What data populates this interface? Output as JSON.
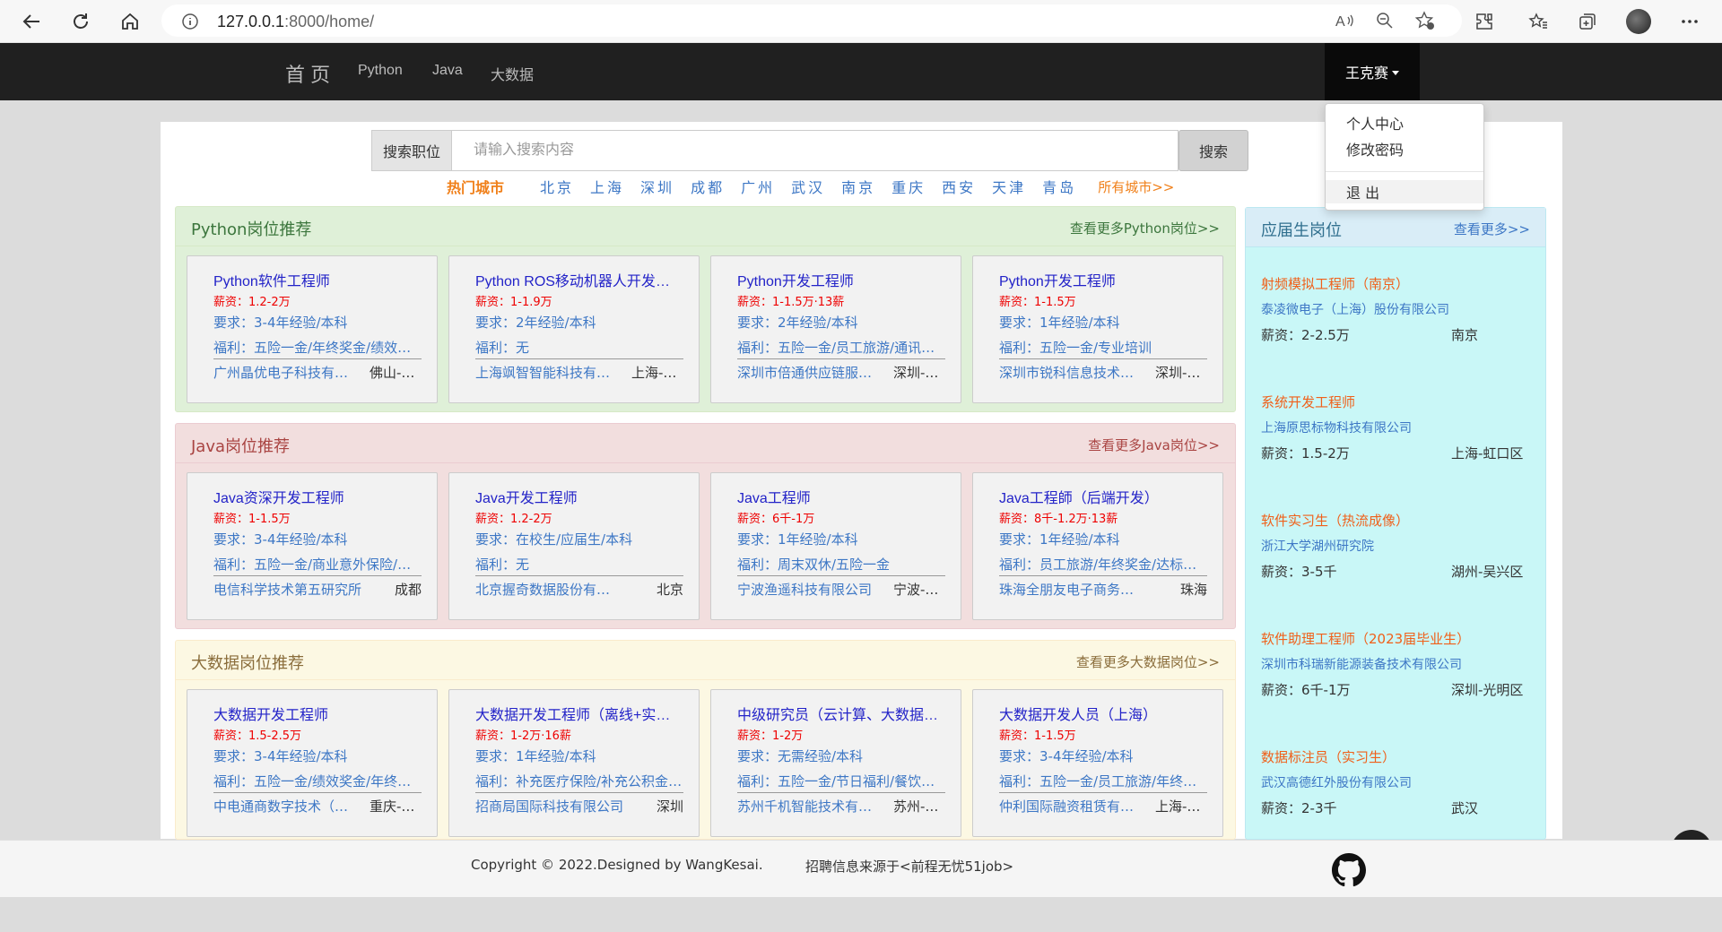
{
  "browser": {
    "url_host": "127.0.0.1",
    "url_rest": ":8000/home/"
  },
  "nav": {
    "brand": "首 页",
    "links": [
      "Python",
      "Java",
      "大数据"
    ],
    "user": "王克赛"
  },
  "dropdown": {
    "items": [
      "个人中心",
      "修改密码",
      "退 出"
    ]
  },
  "search": {
    "label": "搜索职位",
    "placeholder": "请输入搜索内容",
    "button": "搜索"
  },
  "hot_cities": {
    "label": "热门城市",
    "cities": [
      "北京",
      "上海",
      "深圳",
      "成都",
      "广州",
      "武汉",
      "南京",
      "重庆",
      "西安",
      "天津",
      "青岛"
    ],
    "all": "所有城市>>"
  },
  "panels": [
    {
      "title": "Python岗位推荐",
      "more": "查看更多Python岗位>>",
      "cards": [
        {
          "title": "Python软件工程师",
          "salary": "薪资：1.2-2万",
          "req": "要求：3-4年经验/本科",
          "benefit": "福利：五险一金/年终奖金/绩效奖金",
          "company": "广州晶优电子科技有限公司",
          "city": "佛山-顺德区"
        },
        {
          "title": "Python ROS移动机器人开发工程师",
          "salary": "薪资：1-1.9万",
          "req": "要求：2年经验/本科",
          "benefit": "福利：无",
          "company": "上海飒智智能科技有限公司",
          "city": "上海-浦东新区"
        },
        {
          "title": "Python开发工程师",
          "salary": "薪资：1-1.5万·13薪",
          "req": "要求：2年经验/本科",
          "benefit": "福利：五险一金/员工旅游/通讯补贴",
          "company": "深圳市倍通供应链服务有限公司",
          "city": "深圳-南山区"
        },
        {
          "title": "Python开发工程师",
          "salary": "薪资：1-1.5万",
          "req": "要求：1年经验/本科",
          "benefit": "福利：五险一金/专业培训",
          "company": "深圳市锐科信息技术有限公司",
          "city": "深圳-福田区"
        }
      ]
    },
    {
      "title": "Java岗位推荐",
      "more": "查看更多Java岗位>>",
      "cards": [
        {
          "title": "Java资深开发工程师",
          "salary": "薪资：1-1.5万",
          "req": "要求：3-4年经验/本科",
          "benefit": "福利：五险一金/商业意外保险/企业年金",
          "company": "电信科学技术第五研究所",
          "city": "成都"
        },
        {
          "title": "Java开发工程师",
          "salary": "薪资：1.2-2万",
          "req": "要求：在校生/应届生/本科",
          "benefit": "福利：无",
          "company": "北京握奇数据股份有限公司",
          "city": "北京"
        },
        {
          "title": "Java工程师",
          "salary": "薪资：6千-1万",
          "req": "要求：1年经验/本科",
          "benefit": "福利：周末双休/五险一金",
          "company": "宁波渔遥科技有限公司",
          "city": "宁波-鄞州区"
        },
        {
          "title": "Java工程師（后端开发）",
          "salary": "薪资：8千-1.2万·13薪",
          "req": "要求：1年经验/本科",
          "benefit": "福利：员工旅游/年终奖金/达标奖金",
          "company": "珠海全朋友电子商务有限公司",
          "city": "珠海"
        }
      ]
    },
    {
      "title": "大数据岗位推荐",
      "more": "查看更多大数据岗位>>",
      "cards": [
        {
          "title": "大数据开发工程师",
          "salary": "薪资：1.5-2.5万",
          "req": "要求：3-4年经验/本科",
          "benefit": "福利：五险一金/绩效奖金/年终奖金",
          "company": "中电通商数字技术（重庆）有限公司",
          "city": "重庆-渝北区"
        },
        {
          "title": "大数据开发工程师（离线+实时）",
          "salary": "薪资：1-2万·16薪",
          "req": "要求：1年经验/本科",
          "benefit": "福利：补充医疗保险/补充公积金/年终奖金",
          "company": "招商局国际科技有限公司",
          "city": "深圳"
        },
        {
          "title": "中级研究员（云计算、大数据方向）",
          "salary": "薪资：1-2万",
          "req": "要求：无需经验/本科",
          "benefit": "福利：五险一金/节日福利/餐饮补贴",
          "company": "苏州千机智能技术有限公司",
          "city": "苏州-吴中区"
        },
        {
          "title": "大数据开发人员（上海）",
          "salary": "薪资：1-1.5万",
          "req": "要求：3-4年经验/本科",
          "benefit": "福利：五险一金/员工旅游/年终奖金",
          "company": "仲利国际融资租赁有限公司",
          "city": "上海-徐汇区"
        }
      ]
    }
  ],
  "sidebar": {
    "title": "应届生岗位",
    "more": "查看更多>>",
    "items": [
      {
        "job": "射频模拟工程师（南京）",
        "company": "泰凌微电子（上海）股份有限公司",
        "salary": "薪资：2-2.5万",
        "city": "南京"
      },
      {
        "job": "系统开发工程师",
        "company": "上海原思标物科技有限公司",
        "salary": "薪资：1.5-2万",
        "city": "上海-虹口区"
      },
      {
        "job": "软件实习生（热流成像）",
        "company": "浙江大学湖州研究院",
        "salary": "薪资：3-5千",
        "city": "湖州-吴兴区"
      },
      {
        "job": "软件助理工程师（2023届毕业生）",
        "company": "深圳市科瑞新能源装备技术有限公司",
        "salary": "薪资：6千-1万",
        "city": "深圳-光明区"
      },
      {
        "job": "数据标注员（实习生）",
        "company": "武汉高德红外股份有限公司",
        "salary": "薪资：2-3千",
        "city": "武汉"
      }
    ]
  },
  "footer": {
    "copyright": "Copyright © 2022.Designed by WangKesai.",
    "source": "招聘信息来源于<前程无忧51job>"
  }
}
